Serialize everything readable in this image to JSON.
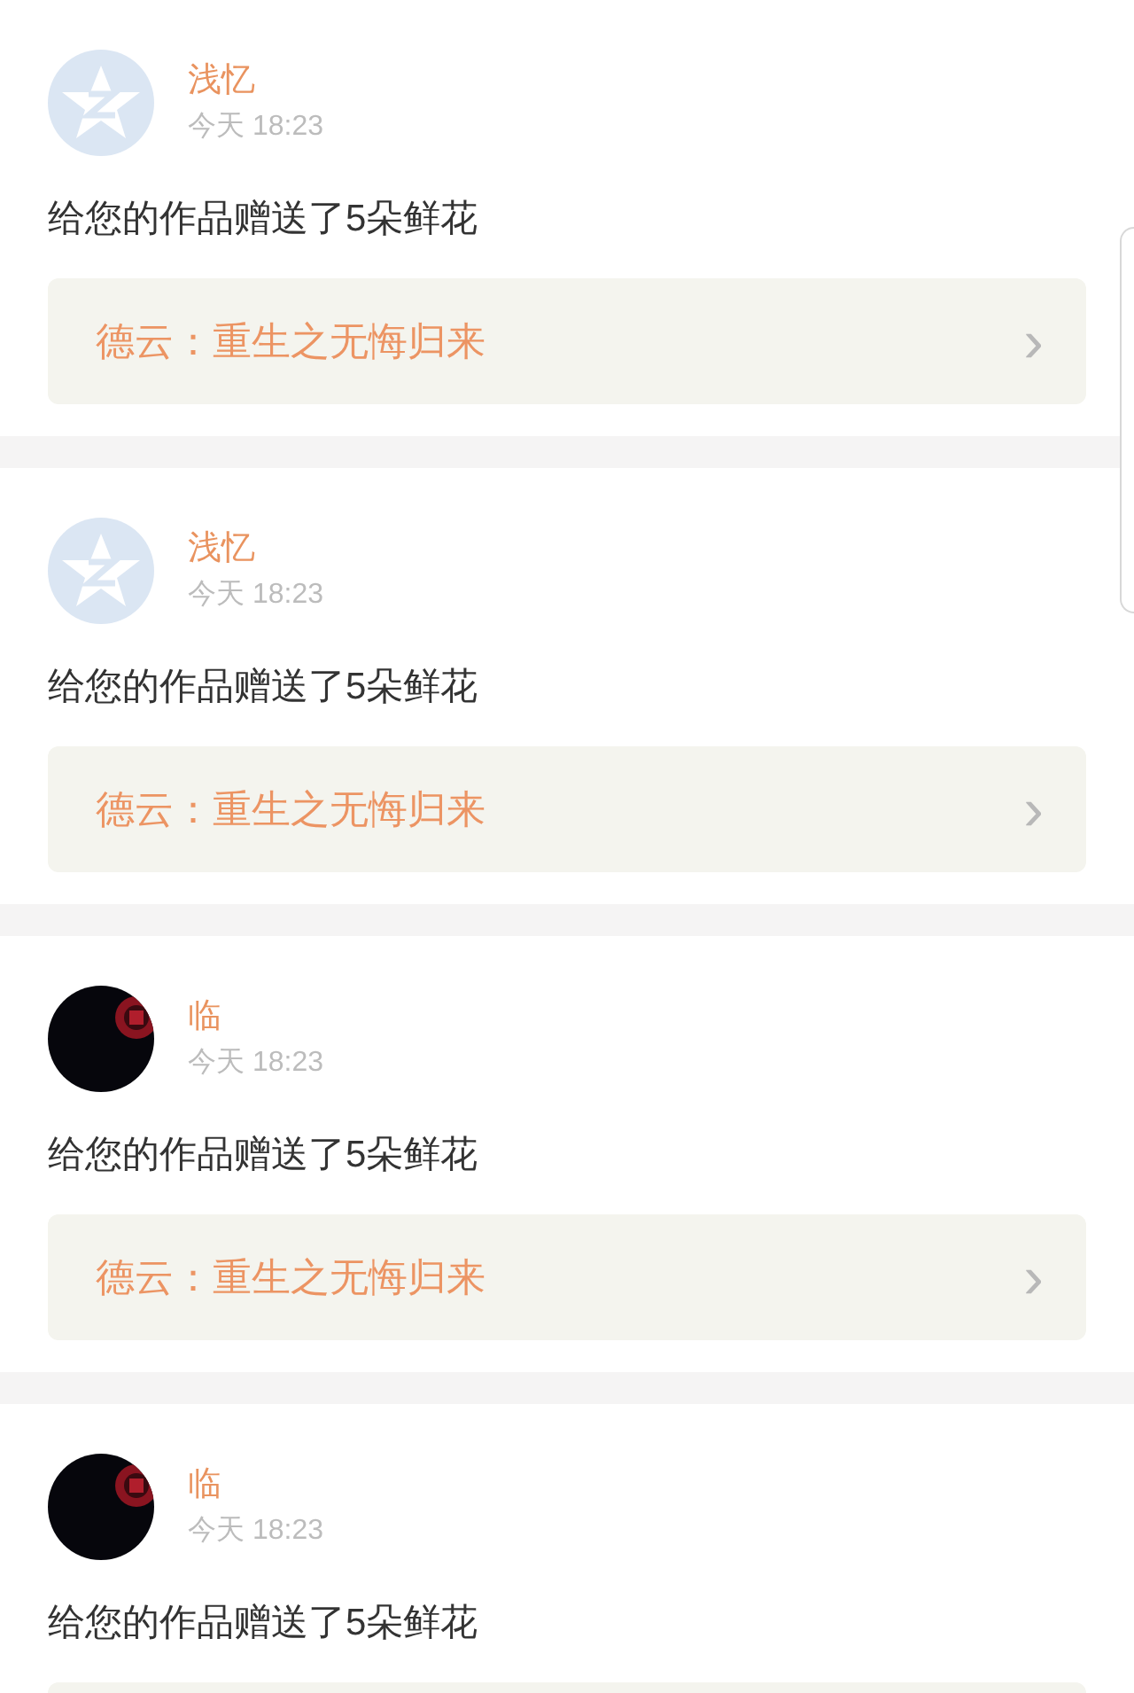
{
  "notifications": [
    {
      "avatar": {
        "kind": "star"
      },
      "name": "浅忆",
      "time": "今天 18:23",
      "message": "给您的作品赠送了5朵鲜花",
      "work": {
        "title": "德云：重生之无悔归来",
        "chevron": "›"
      }
    },
    {
      "avatar": {
        "kind": "star"
      },
      "name": "浅忆",
      "time": "今天 18:23",
      "message": "给您的作品赠送了5朵鲜花",
      "work": {
        "title": "德云：重生之无悔归来",
        "chevron": "›"
      }
    },
    {
      "name": "临",
      "time": "今天 18:23",
      "message": "给您的作品赠送了5朵鲜花",
      "work": {
        "title": "德云：重生之无悔归来",
        "chevron": "›"
      }
    },
    {
      "name": "临",
      "time": "今天 18:23",
      "message": "给您的作品赠送了5朵鲜花"
    }
  ]
}
